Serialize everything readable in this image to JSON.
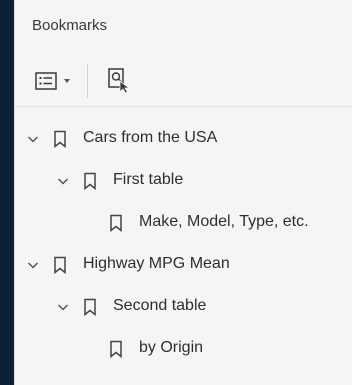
{
  "panel": {
    "title": "Bookmarks"
  },
  "toolbar": {
    "options_icon": "list-options-icon",
    "dropdown_icon": "chevron-down-icon",
    "find_icon": "find-bookmark-icon"
  },
  "bookmarks": [
    {
      "label": "Cars from the USA",
      "level": 0,
      "expanded": true
    },
    {
      "label": "First table",
      "level": 1,
      "expanded": true
    },
    {
      "label": "Make, Model, Type, etc.",
      "level": 2,
      "expanded": null
    },
    {
      "label": "Highway MPG Mean",
      "level": 0,
      "expanded": true
    },
    {
      "label": "Second table",
      "level": 1,
      "expanded": true
    },
    {
      "label": "by Origin",
      "level": 2,
      "expanded": null
    }
  ]
}
